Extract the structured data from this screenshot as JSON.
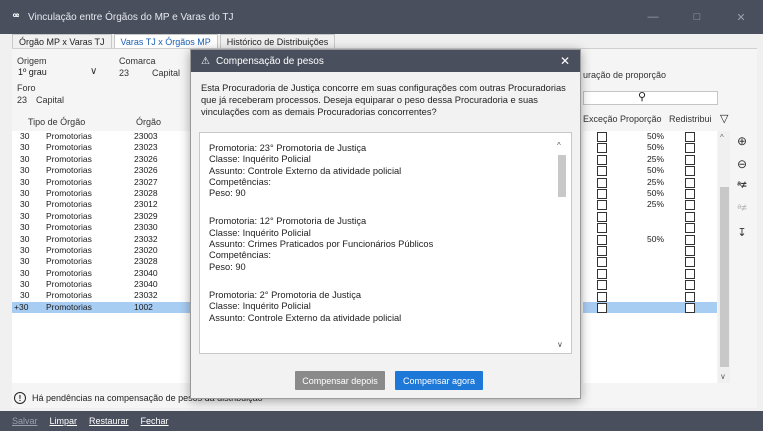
{
  "window": {
    "title": "Vinculação entre Órgãos do MP e Varas do TJ"
  },
  "tabs": [
    {
      "label": "Órgão MP x Varas TJ"
    },
    {
      "label": "Varas TJ x Órgãos MP"
    },
    {
      "label": "Histórico de Distribuições"
    }
  ],
  "filters": {
    "origem_label": "Origem",
    "origem_value": "1º grau",
    "comarca_label": "Comarca",
    "comarca_code": "23",
    "comarca_name": "Capital",
    "foro_label": "Foro",
    "foro_code": "23",
    "foro_name": "Capital",
    "proporcao_label": "uração de proporção"
  },
  "grid": {
    "headers": [
      "Tipo de Órgão",
      "Órgão"
    ],
    "rows": [
      [
        "30",
        "Promotorias",
        "23003"
      ],
      [
        "30",
        "Promotorias",
        "23023"
      ],
      [
        "30",
        "Promotorias",
        "23026"
      ],
      [
        "30",
        "Promotorias",
        "23026"
      ],
      [
        "30",
        "Promotorias",
        "23027"
      ],
      [
        "30",
        "Promotorias",
        "23028"
      ],
      [
        "30",
        "Promotorias",
        "23012"
      ],
      [
        "30",
        "Promotorias",
        "23029"
      ],
      [
        "30",
        "Promotorias",
        "23030"
      ],
      [
        "30",
        "Promotorias",
        "23032"
      ],
      [
        "30",
        "Promotorias",
        "23020"
      ],
      [
        "30",
        "Promotorias",
        "23028"
      ],
      [
        "30",
        "Promotorias",
        "23040"
      ],
      [
        "30",
        "Promotorias",
        "23040"
      ],
      [
        "30",
        "Promotorias",
        "23032"
      ],
      [
        "+30",
        "Promotorias",
        "1002"
      ]
    ]
  },
  "right_grid": {
    "headers": [
      "Exceção",
      "Proporção",
      "Redistribui"
    ],
    "proportions": [
      "50%",
      "50%",
      "25%",
      "50%",
      "25%",
      "50%",
      "25%",
      "",
      "",
      "50%",
      "",
      "",
      "",
      "",
      "",
      ""
    ]
  },
  "side_icons": [
    "add-icon",
    "remove-icon",
    "filter-a-icon",
    "filter-b-icon",
    "sort-icon"
  ],
  "bottom_message": "Há pendências na compensação de pesos da distribuição",
  "footer": {
    "salvar": "Salvar",
    "limpar": "Limpar",
    "restaurar": "Restaurar",
    "fechar": "Fechar"
  },
  "dialog": {
    "title": "Compensação de pesos",
    "message": "Esta Procuradoria de Justiça concorre em suas configurações com outras Procuradorias que já receberam processos. Deseja equiparar o peso dessa Procuradoria e suas vinculações com as demais Procuradorias concorrentes?",
    "items": [
      {
        "promotoria": "Promotoria: 23° Promotoria de Justiça",
        "classe": "Classe: Inquérito Policial",
        "assunto": "Assunto: Controle Externo da atividade policial",
        "competencias": "Competências:",
        "peso": "Peso: 90"
      },
      {
        "promotoria": "Promotoria: 12° Promotoria de Justiça",
        "classe": "Classe: Inquérito Policial",
        "assunto": "Assunto: Crimes Praticados por Funcionários Públicos",
        "competencias": "Competências:",
        "peso": "Peso: 90"
      },
      {
        "promotoria": "Promotoria: 2° Promotoria de Justiça",
        "classe": "Classe: Inquérito Policial",
        "assunto": "Assunto: Controle Externo da atividade policial",
        "competencias": "",
        "peso": ""
      }
    ],
    "btn_later": "Compensar depois",
    "btn_now": "Compensar agora"
  }
}
